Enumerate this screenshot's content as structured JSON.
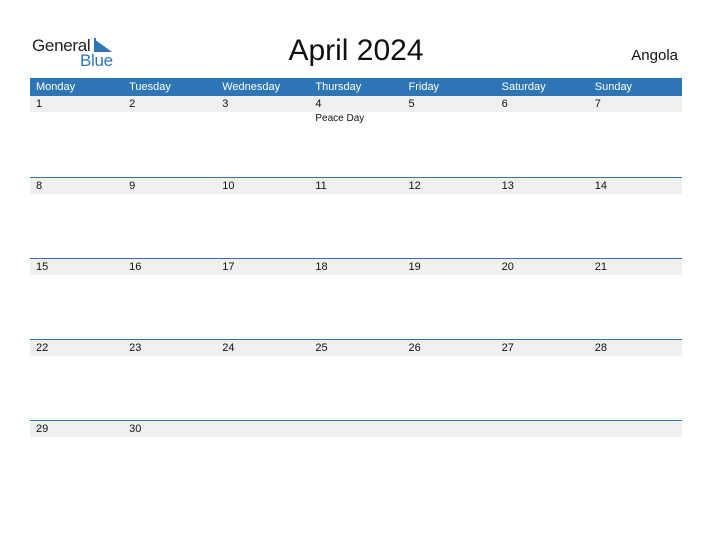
{
  "logo": {
    "general": "General",
    "blue": "Blue"
  },
  "title": "April 2024",
  "country": "Angola",
  "accent_color": "#2e75b6",
  "weekdays": [
    "Monday",
    "Tuesday",
    "Wednesday",
    "Thursday",
    "Friday",
    "Saturday",
    "Sunday"
  ],
  "weeks": [
    {
      "days": [
        "1",
        "2",
        "3",
        "4",
        "5",
        "6",
        "7"
      ],
      "events": [
        "",
        "",
        "",
        "Peace Day",
        "",
        "",
        ""
      ]
    },
    {
      "days": [
        "8",
        "9",
        "10",
        "11",
        "12",
        "13",
        "14"
      ],
      "events": [
        "",
        "",
        "",
        "",
        "",
        "",
        ""
      ]
    },
    {
      "days": [
        "15",
        "16",
        "17",
        "18",
        "19",
        "20",
        "21"
      ],
      "events": [
        "",
        "",
        "",
        "",
        "",
        "",
        ""
      ]
    },
    {
      "days": [
        "22",
        "23",
        "24",
        "25",
        "26",
        "27",
        "28"
      ],
      "events": [
        "",
        "",
        "",
        "",
        "",
        "",
        ""
      ]
    },
    {
      "days": [
        "29",
        "30",
        "",
        "",
        "",
        "",
        ""
      ],
      "events": [
        "",
        "",
        "",
        "",
        "",
        "",
        ""
      ]
    }
  ]
}
